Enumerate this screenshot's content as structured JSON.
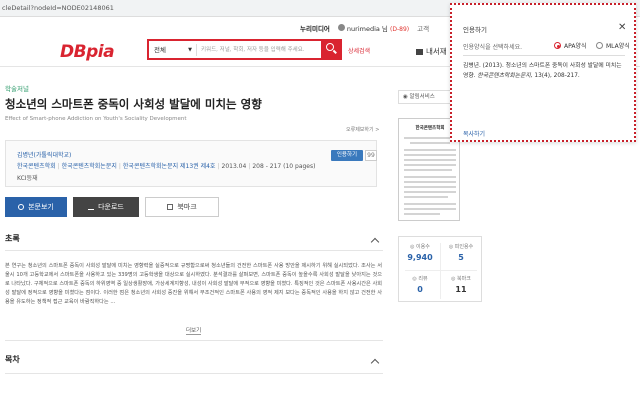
{
  "browser": {
    "url": "cleDetail?nodeId=NODE02148061"
  },
  "header": {
    "nav_brand": "누리미디어",
    "user": "nurimedia 님",
    "points": "(D-89)",
    "etc": "고객",
    "logo": "DBpia",
    "search_scope": "전체",
    "search_placeholder": "키워드, 저널, 학회, 저자 등을 입력해 주세요.",
    "detail_search": "상세검색",
    "my_library": "내서재"
  },
  "article": {
    "kind": "학술저널",
    "title": "청소년의 스마트폰 중독이 사회성 발달에 미치는 영향",
    "subtitle": "Effect of Smart-phone Addiction on Youth's Sociality Development",
    "view_more": "오류제보하기 >",
    "author": "김병년(가톨릭대학교)",
    "publisher1": "한국콘텐츠학회",
    "publisher2": "한국콘텐츠학회논문지",
    "issue": "한국콘텐츠학회논문지 제13권 제4호",
    "date": "2013.04",
    "pages": "208 - 217 (10 pages)",
    "kci": "KCI등재",
    "cite_button": "인용하기",
    "quote_button": "99",
    "btn_view": "본문보기",
    "btn_download": "다운로드",
    "btn_bookmark": "북마크"
  },
  "sections": {
    "abstract_title": "초록",
    "abstract_text": "본 연구는 청소년의 스마트폰 중독이 사회성 발달에 미치는 영향력을 실증적으로 규명함으로써 청소년들의 건전한 스마트폰 사용 방안을 제시하기 위해 실시되었다. 조사는 서울시 10개 고등학교에서 스마트폰을 사용하고 있는 339명의 고등학생을 대상으로 실시하였다. 분석결과를 살펴보면, 스마트폰 중독이 높을수록 사회성 발달을 낮아지는 것으로 나타났다. 구체적으로 스마트폰 중독의 하위영역 중 일상생활장애, 가상세계지향성, 내성이 사회성 발달에 부적으로 영향을 미쳤다. 특징적인 것은 스마트폰 사용시간은 사회성 발달에 정적으로 영향을 미쳤다는 점이다. 이러한 점은 청소년의 사회성 증진을 위해서 무조건적인 스마트폰 사용의 영적 제지 보다는 중독적인 사용을 하지 않고 건전한 사용을 유도하는 정책적 접근 교육이 바람직하다는 ...",
    "more": "더보기",
    "toc_title": "목차"
  },
  "sidebar": {
    "alert_btn": "◉ 알림서비스",
    "thumb_title": "한국콘텐츠학회",
    "stats": [
      {
        "label": "◎ 이용수",
        "value": "9,940"
      },
      {
        "label": "◎ 피인용수",
        "value": "5"
      },
      {
        "label": "◎ 리뷰",
        "value": "0"
      },
      {
        "label": "◎ 북마크",
        "value": "11"
      }
    ]
  },
  "popup": {
    "title": "인용하기",
    "close": "✕",
    "pick": "인용양식을 선택하세요.",
    "opt1": "APA양식",
    "opt2": "MLA양식",
    "citation_main": "김병년. (2013). 청소년의 스마트폰 중독이 사회성 발달에 미치는 영향. ",
    "citation_journal": "한국콘텐츠학회논문지,",
    "citation_tail": " 13(4), 208-217.",
    "copy": "복사하기"
  }
}
